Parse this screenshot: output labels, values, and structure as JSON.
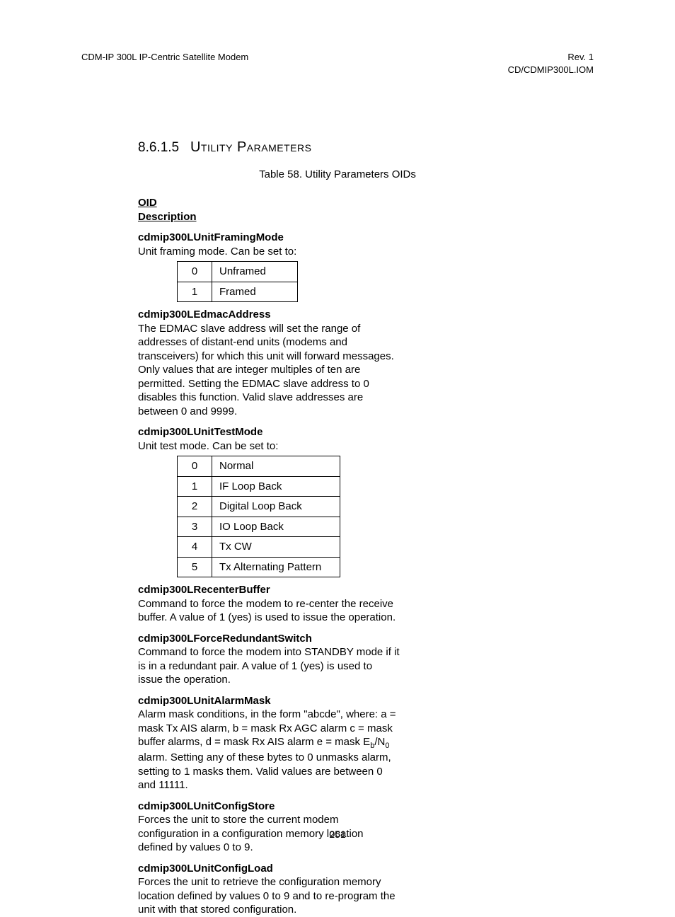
{
  "header": {
    "left": "CDM-IP 300L IP-Centric Satellite Modem",
    "right1": "Rev. 1",
    "right2": "CD/CDMIP300L.IOM"
  },
  "section": {
    "number": "8.6.1.5",
    "title": "Utility Parameters"
  },
  "caption": "Table 58. Utility Parameters OIDs",
  "thead": {
    "c1": "OID",
    "c2": "Description"
  },
  "rows": {
    "r1": {
      "oid": "cdmip300LUnitFramingMode",
      "pre": "Unit framing mode. Can be set to:",
      "opts": [
        {
          "k": "0",
          "v": "Unframed"
        },
        {
          "k": "1",
          "v": "Framed"
        }
      ]
    },
    "r2": {
      "oid": "cdmip300LEdmacAddress",
      "desc": "The EDMAC slave address will set the range of addresses of distant-end units (modems and transceivers) for which this unit will forward messages. Only values that are integer multiples of ten are permitted. Setting the EDMAC slave address to 0 disables this function.  Valid slave addresses are between 0 and 9999."
    },
    "r3": {
      "oid": "cdmip300LUnitTestMode",
      "pre": "Unit test mode. Can be set to:",
      "opts": [
        {
          "k": "0",
          "v": "Normal"
        },
        {
          "k": "1",
          "v": "IF Loop Back"
        },
        {
          "k": "2",
          "v": "Digital Loop Back"
        },
        {
          "k": "3",
          "v": "IO Loop Back"
        },
        {
          "k": "4",
          "v": "Tx CW"
        },
        {
          "k": "5",
          "v": "Tx Alternating Pattern"
        }
      ]
    },
    "r4": {
      "oid": "cdmip300LRecenterBuffer",
      "desc": "Command to force the modem to re-center the receive buffer.  A value of 1 (yes) is used to issue the operation."
    },
    "r5": {
      "oid": "cdmip300LForceRedundantSwitch",
      "desc": "Command to force the modem into STANDBY mode if it is in a redundant pair.  A value of 1 (yes) is used to issue the operation."
    },
    "r6": {
      "oid": "cdmip300LUnitAlarmMask",
      "desc_a": "Alarm mask conditions, in the form \"abcde\", where: a = mask Tx AIS alarm, b = mask Rx AGC alarm c = mask buffer alarms, d = mask Rx AIS alarm e = mask E",
      "desc_b": "/N",
      "desc_c": " alarm. Setting any of these bytes to 0 unmasks alarm, setting to 1 masks them. Valid values are between 0 and 11111.",
      "sub1": "b",
      "sub2": "0"
    },
    "r7": {
      "oid": "cdmip300LUnitConfigStore",
      "desc": "Forces the unit to store the current modem configuration in a configuration memory location defined by values 0 to 9."
    },
    "r8": {
      "oid": "cdmip300LUnitConfigLoad",
      "desc": "Forces the unit to retrieve the configuration memory location defined by values 0 to 9 and to re-program the unit with that stored configuration."
    }
  },
  "pagenum": "251"
}
